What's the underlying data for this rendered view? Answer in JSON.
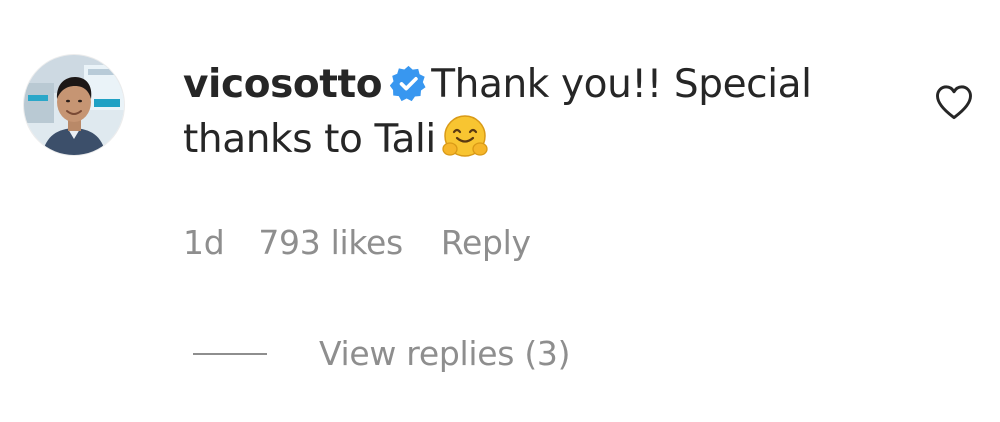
{
  "comment": {
    "username": "vicosotto",
    "verified": true,
    "text_line1": "Thank you!! Special",
    "text_line2": "thanks to Tali",
    "emoji": "hugging-face-emoji",
    "time": "1d",
    "likes": "793 likes",
    "reply_label": "Reply",
    "view_replies_label": "View replies (3)",
    "liked": false
  },
  "colors": {
    "text": "#262626",
    "secondary_text": "#8e8e8e",
    "verified_badge": "#3897f0",
    "background": "#ffffff"
  },
  "icons": {
    "verified": "verified-badge-icon",
    "like": "heart-outline-icon"
  }
}
